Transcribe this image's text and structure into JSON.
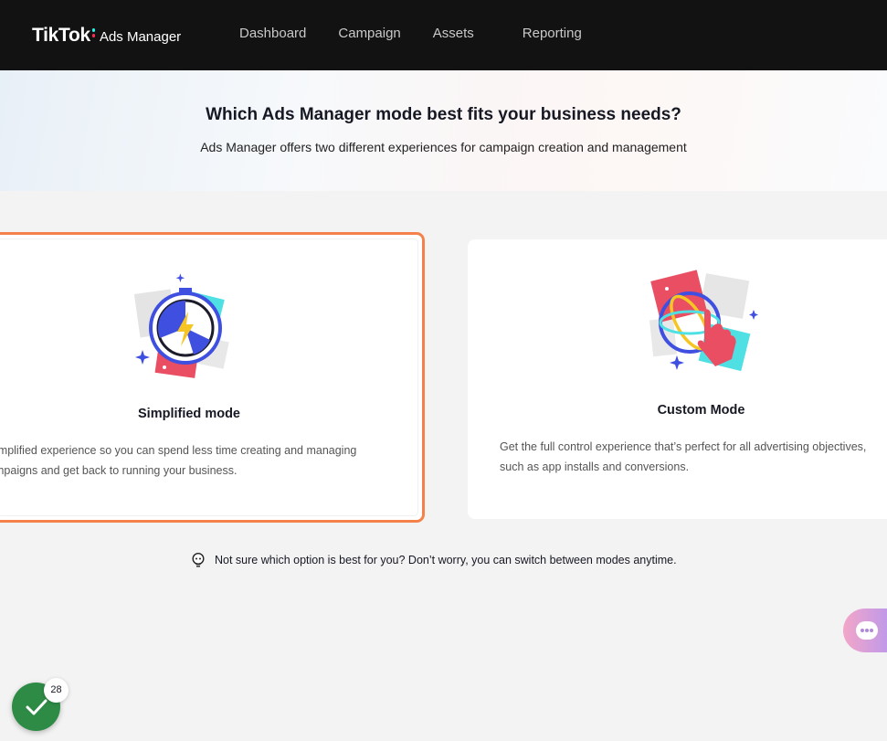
{
  "brand": {
    "name": "TikTok",
    "product": "Ads Manager"
  },
  "nav": {
    "items": [
      {
        "label": "Dashboard"
      },
      {
        "label": "Campaign"
      },
      {
        "label": "Assets"
      },
      {
        "label": "Reporting"
      }
    ]
  },
  "hero": {
    "title": "Which Ads Manager mode best fits your business needs?",
    "subtitle": "Ads Manager offers two different experiences for campaign creation and management"
  },
  "modes": {
    "simplified": {
      "title": "Simplified mode",
      "description_line1": "implified experience so you can spend less time creating and managing",
      "description_line2": "mpaigns and get back to running your business.",
      "selected": true,
      "icon": "stopwatch-lightning-icon"
    },
    "custom": {
      "title": "Custom Mode",
      "description_line1": "Get the full control experience that’s perfect for all advertising objectives,",
      "description_line2": "such as app installs and conversions.",
      "selected": false,
      "icon": "globe-hand-icon"
    }
  },
  "hint": {
    "text": "Not sure which option is best for you? Don’t worry, you can switch between modes anytime."
  },
  "task_badge": {
    "count": "28"
  },
  "colors": {
    "topbar": "#121212",
    "selected_border": "#f5814a",
    "task_green": "#2e8b46",
    "accent_blue": "#3f4fe0",
    "accent_red": "#ea4e63",
    "accent_cyan": "#4fe0e4"
  }
}
